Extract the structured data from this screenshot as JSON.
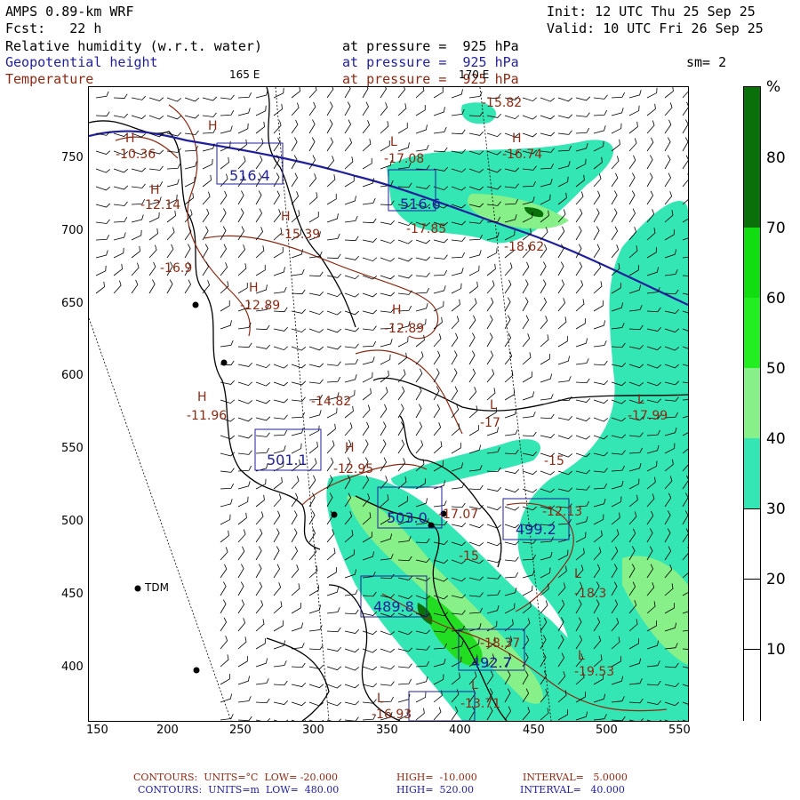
{
  "header": {
    "model": "AMPS 0.89-km WRF",
    "init": "Init: 12 UTC Thu 25 Sep 25",
    "fcst": "Fcst:   22 h",
    "valid": "Valid: 10 UTC Fri 26 Sep 25",
    "field1": "Relative humidity (w.r.t. water)",
    "field1_level": "at pressure =  925 hPa",
    "field2": "Geopotential height",
    "field2_level": "at pressure =  925 hPa",
    "smoothing": "sm= 2",
    "field3": "Temperature",
    "field3_level": "at pressure =  925 hPa",
    "lon_label_1": "165 E",
    "lon_label_2": "170 E"
  },
  "axes": {
    "x_ticks": [
      "150",
      "200",
      "250",
      "300",
      "350",
      "400",
      "450",
      "500",
      "550"
    ],
    "y_ticks": [
      "750",
      "700",
      "650",
      "600",
      "550",
      "500",
      "450",
      "400"
    ]
  },
  "colorbar": {
    "unit": "%",
    "labels": [
      "80",
      "70",
      "60",
      "50",
      "40",
      "30",
      "20",
      "10"
    ],
    "colors": [
      "#ffffff",
      "#ffffff",
      "#ffffff",
      "#33e6b3",
      "#88f088",
      "#22dd22",
      "#11aa11",
      "#0a700a"
    ]
  },
  "map_labels": {
    "temps": [
      {
        "t": "-10.36"
      },
      {
        "t": "-12.14"
      },
      {
        "t": "-16.9"
      },
      {
        "t": "-15.39"
      },
      {
        "t": "-12.89"
      },
      {
        "t": "-17.08"
      },
      {
        "t": "-16.74"
      },
      {
        "t": "-15.82"
      },
      {
        "t": "-17.85"
      },
      {
        "t": "-18.62"
      },
      {
        "t": "-12.89"
      },
      {
        "t": "-14.82"
      },
      {
        "t": "-11.96"
      },
      {
        "t": "-12.95"
      },
      {
        "t": "-17.99"
      },
      {
        "t": "-17"
      },
      {
        "t": "-18.3"
      },
      {
        "t": "-19.53"
      },
      {
        "t": "-16.93"
      },
      {
        "t": "-13.71"
      },
      {
        "t": "-18.37"
      },
      {
        "t": "-12.13"
      },
      {
        "t": "-17.07"
      },
      {
        "t": "-15"
      },
      {
        "t": "-15"
      }
    ],
    "heights": [
      {
        "t": "516.4"
      },
      {
        "t": "516.6"
      },
      {
        "t": "501.1"
      },
      {
        "t": "503.0"
      },
      {
        "t": "499.2"
      },
      {
        "t": "489.8"
      },
      {
        "t": "492.7"
      }
    ],
    "station": "TDM",
    "hl_H": "H",
    "hl_L": "L"
  },
  "footer": {
    "line1_a": "CONTOURS:  UNITS=°C  LOW= -20.000",
    "line1_b": "HIGH=  -10.000",
    "line1_c": "INTERVAL=   5.0000",
    "line2_a": "CONTOURS:  UNITS=m  LOW=  480.00",
    "line2_b": "HIGH=  520.00",
    "line2_c": "INTERVAL=   40.000"
  }
}
